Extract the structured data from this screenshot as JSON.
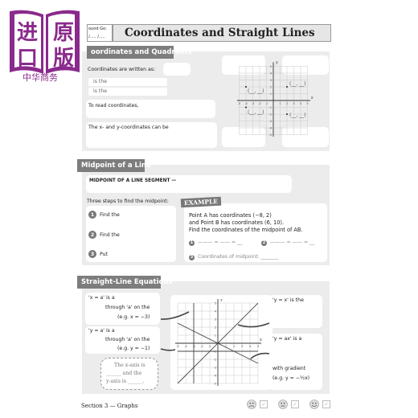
{
  "logo": {
    "chars": [
      "进",
      "原",
      "口",
      "版"
    ],
    "subtitle": "中华商务"
  },
  "header": {
    "round_go_label": "ound Go:",
    "round_go_blanks": "/..... /.....",
    "title": "Coordinates and Straight Lines"
  },
  "section1": {
    "heading": "oordinates and Quadrants",
    "written_as": "Coordinates are written as:",
    "is_the_1": "is the",
    "is_the_2": "is the",
    "to_read": "To read coordinates,",
    "xy_can_be": "The x- and y-coordinates can be",
    "graph": {
      "x_label": "x",
      "y_label": "y",
      "ticks": [
        "-5",
        "-4",
        "-3",
        "-2",
        "-1",
        "0",
        "1",
        "2",
        "3",
        "4",
        "5"
      ],
      "point_blank": "(__, __)"
    }
  },
  "section2": {
    "heading": "Midpoint of a Line",
    "definition": "MIDPOINT OF A LINE SEGMENT —",
    "steps_intro": "Three steps to find the midpoint:",
    "steps": [
      {
        "n": "1",
        "text": "Find the"
      },
      {
        "n": "2",
        "text": "Find the"
      },
      {
        "n": "3",
        "text": "Put"
      }
    ],
    "example": {
      "badge": "EXAMPLE",
      "line1": "Point A has coordinates (−8, 2)",
      "line2": "and Point B has coordinates (6, 10).",
      "line3": "Find the coordinates of the midpoint of AB.",
      "work1": "——— = —— = __",
      "work2": "——— = —— = __",
      "step3": "Coordinates of midpoint: _______"
    }
  },
  "section3": {
    "heading": "Straight-Line Equations",
    "xa": {
      "l1": "'x = a' is a",
      "l2": "through 'a' on the",
      "l3": "(e.g. x = −3)"
    },
    "ya": {
      "l1": "'y = a' is a",
      "l2": "through 'a' on the",
      "l3": "(e.g. y = −1)"
    },
    "axes_note": {
      "l1": "The x-axis is",
      "l2": "______ and the",
      "l3": "y-axis is ______."
    },
    "yx": "'y = x' is the",
    "yax": {
      "l1": "'y = ax' is a",
      "l2": "with gradient",
      "l3": "(e.g. y = −½x)"
    },
    "graph": {
      "x_label": "x",
      "y_label": "y"
    }
  },
  "footer": {
    "section": "Section 3 — Graphs",
    "faces": [
      "sad",
      "neutral",
      "happy"
    ]
  }
}
